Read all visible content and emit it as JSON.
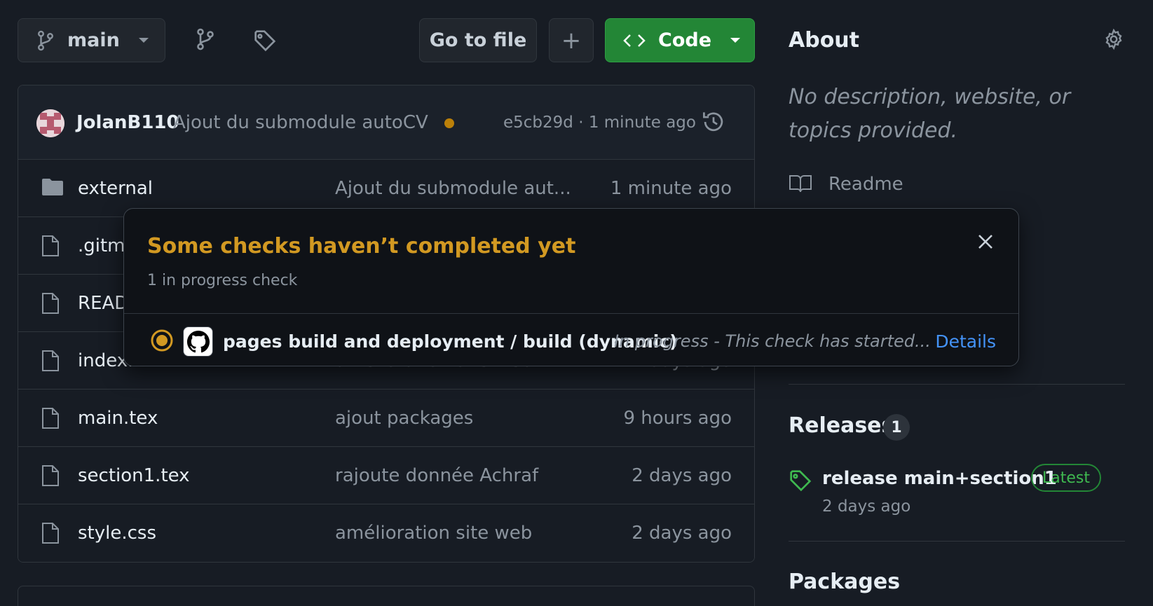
{
  "toolbar": {
    "branch_label": "main",
    "goto_file_label": "Go to file",
    "add_label": "+",
    "code_label": "Code"
  },
  "latest_commit": {
    "author": "JolanB110",
    "message": "Ajout du submodule autoCV",
    "meta": "e5cb29d · 1 minute ago"
  },
  "files": [
    {
      "name": "external",
      "type": "folder",
      "message": "Ajout du submodule aut...",
      "time": "1 minute ago"
    },
    {
      "name": ".gitm",
      "type": "file",
      "message": "",
      "time": ""
    },
    {
      "name": "READ",
      "type": "file",
      "message": "",
      "time": ""
    },
    {
      "name": "index.html",
      "type": "file",
      "message": "amélioration site web",
      "time": "2 days ago"
    },
    {
      "name": "main.tex",
      "type": "file",
      "message": "ajout packages",
      "time": "9 hours ago"
    },
    {
      "name": "section1.tex",
      "type": "file",
      "message": "rajoute donnée Achraf",
      "time": "2 days ago"
    },
    {
      "name": "style.css",
      "type": "file",
      "message": "amélioration site web",
      "time": "2 days ago"
    }
  ],
  "about": {
    "title": "About",
    "description": "No description, website, or topics provided.",
    "readme_label": "Readme"
  },
  "releases": {
    "title": "Releases",
    "count": "1",
    "latest_name": "release main+section1",
    "latest_badge": "Latest",
    "latest_time": "2 days ago"
  },
  "packages": {
    "title": "Packages"
  },
  "popover": {
    "title": "Some checks haven’t completed yet",
    "subtitle": "1 in progress check",
    "check_name": "pages build and deployment / build (dynamic)",
    "check_status": "In progress - This check has started...",
    "details_label": "Details"
  },
  "colors": {
    "background": "#171c24",
    "accent_green": "#238636",
    "warning": "#d29922",
    "link": "#4493f8"
  }
}
